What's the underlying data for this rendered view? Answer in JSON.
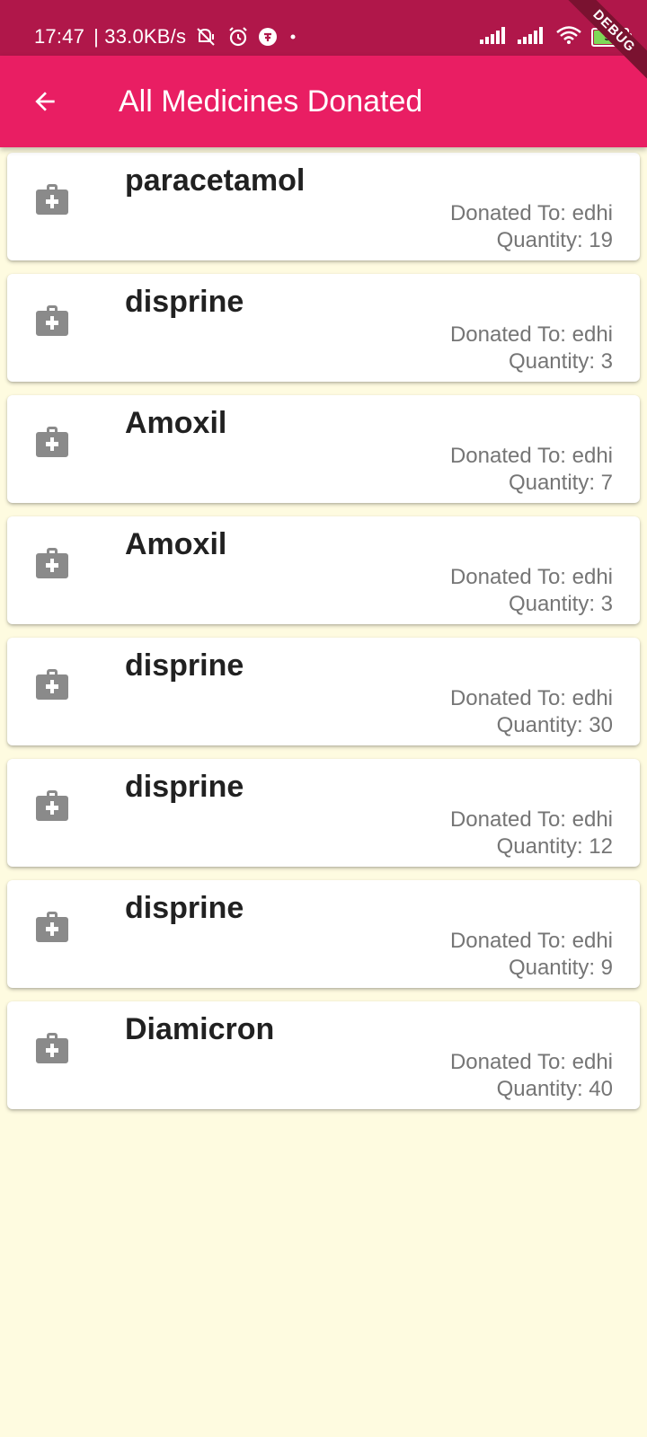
{
  "status_bar": {
    "time": "17:47",
    "network_speed": "| 33.0KB/s",
    "battery_level": "98",
    "icons": [
      "mute-icon",
      "alarm-icon",
      "app-notification-icon",
      "dot-icon",
      "signal-icon",
      "signal-icon",
      "wifi-icon",
      "battery-icon"
    ]
  },
  "debug_banner": "DEBUG",
  "app_bar": {
    "title": "All Medicines Donated",
    "back_icon": "arrow-back-icon",
    "background_color": "#e91e63"
  },
  "medicines": [
    {
      "name": "paracetamol",
      "donated_to": "Donated To: edhi",
      "quantity": "Quantity: 19"
    },
    {
      "name": "disprine",
      "donated_to": "Donated To: edhi",
      "quantity": "Quantity: 3"
    },
    {
      "name": "Amoxil",
      "donated_to": "Donated To: edhi",
      "quantity": "Quantity: 7"
    },
    {
      "name": "Amoxil",
      "donated_to": "Donated To: edhi",
      "quantity": "Quantity: 3"
    },
    {
      "name": "disprine",
      "donated_to": "Donated To: edhi",
      "quantity": "Quantity: 30"
    },
    {
      "name": "disprine",
      "donated_to": "Donated To: edhi",
      "quantity": "Quantity: 12"
    },
    {
      "name": "disprine",
      "donated_to": "Donated To: edhi",
      "quantity": "Quantity: 9"
    },
    {
      "name": "Diamicron",
      "donated_to": "Donated To: edhi",
      "quantity": "Quantity: 40"
    }
  ],
  "item_icon": "medical-kit-icon",
  "colors": {
    "status_bar": "#b0174a",
    "page_background": "#fefbe0",
    "icon_gray": "#8a8a8a"
  }
}
